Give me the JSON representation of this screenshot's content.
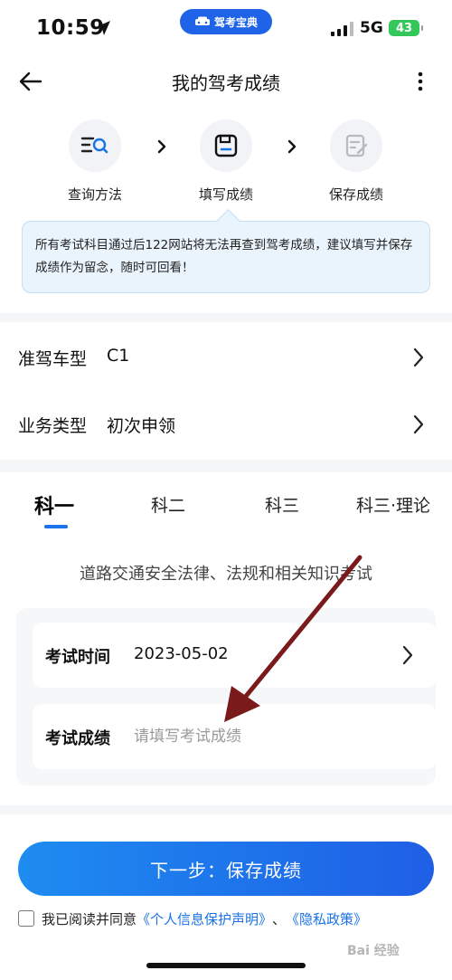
{
  "status_bar": {
    "time": "10:59",
    "network": "5G",
    "battery": "43",
    "app_badge": "驾考宝典"
  },
  "nav": {
    "title": "我的驾考成绩"
  },
  "steps": [
    {
      "label": "查询方法",
      "icon": "search-list-icon"
    },
    {
      "label": "填写成绩",
      "icon": "save-disk-icon"
    },
    {
      "label": "保存成绩",
      "icon": "edit-doc-icon"
    }
  ],
  "tip": "所有考试科目通过后122网站将无法再查到驾考成绩，建议填写并保存成绩作为留念，随时可回看！",
  "rows": {
    "vehicle_type": {
      "label": "准驾车型",
      "value": "C1"
    },
    "business_type": {
      "label": "业务类型",
      "value": "初次申领"
    }
  },
  "tabs": [
    {
      "label": "科一",
      "active": true
    },
    {
      "label": "科二",
      "active": false
    },
    {
      "label": "科三",
      "active": false
    },
    {
      "label": "科三·理论",
      "active": false
    }
  ],
  "subject_description": "道路交通安全法律、法规和相关知识考试",
  "form": {
    "exam_time_label": "考试时间",
    "exam_time_value": "2023-05-02",
    "exam_score_label": "考试成绩",
    "exam_score_placeholder": "请填写考试成绩",
    "exam_score_value": ""
  },
  "primary_button": "下一步：保存成绩",
  "agreement": {
    "prefix": "我已阅读并同意",
    "link1": "《个人信息保护声明》",
    "separator": "、",
    "link2": "《隐私政策》"
  },
  "watermark": "Bai 经验",
  "colors": {
    "accent": "#1a73e8",
    "tip_bg": "#eaf4fd",
    "annotation_arrow": "#7a1a1a",
    "battery": "#34c759"
  }
}
